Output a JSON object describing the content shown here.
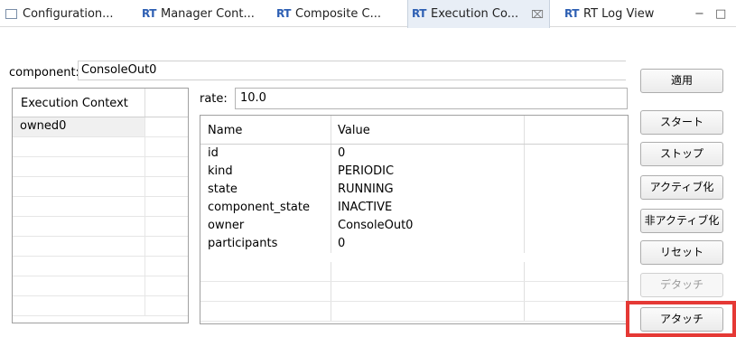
{
  "tabs": [
    {
      "label": "Configuration...",
      "icon": "config-view-icon"
    },
    {
      "label": "Manager Cont...",
      "icon": "rt-icon"
    },
    {
      "label": "Composite C...",
      "icon": "rt-icon"
    },
    {
      "label": "Execution Co...",
      "icon": "rt-icon",
      "active": true
    },
    {
      "label": "RT Log View",
      "icon": "rt-icon"
    }
  ],
  "rt_icon_text": "RT",
  "close_glyph": "⌧",
  "window_controls": {
    "minimize": "−",
    "maximize": "□"
  },
  "component": {
    "label": "component:",
    "value": "ConsoleOut0"
  },
  "left_table": {
    "header": "Execution Context",
    "rows": [
      "owned0"
    ]
  },
  "rate": {
    "label": "rate:",
    "value": "10.0"
  },
  "properties": {
    "headers": [
      "Name",
      "Value"
    ],
    "rows": [
      {
        "name": "id",
        "value": "0"
      },
      {
        "name": "kind",
        "value": "PERIODIC"
      },
      {
        "name": "state",
        "value": "RUNNING"
      },
      {
        "name": "component_state",
        "value": "INACTIVE"
      },
      {
        "name": "owner",
        "value": "ConsoleOut0"
      },
      {
        "name": "participants",
        "value": "0"
      }
    ]
  },
  "buttons": {
    "apply": "適用",
    "start": "スタート",
    "stop": "ストップ",
    "activate": "アクティブ化",
    "deactivate": "非アクティブ化",
    "reset": "リセット",
    "detach": "デタッチ",
    "attach": "アタッチ"
  },
  "colors": {
    "highlight": "#e53935",
    "rt_icon": "#2d5fb3",
    "active_tab": "#e8eef6"
  }
}
